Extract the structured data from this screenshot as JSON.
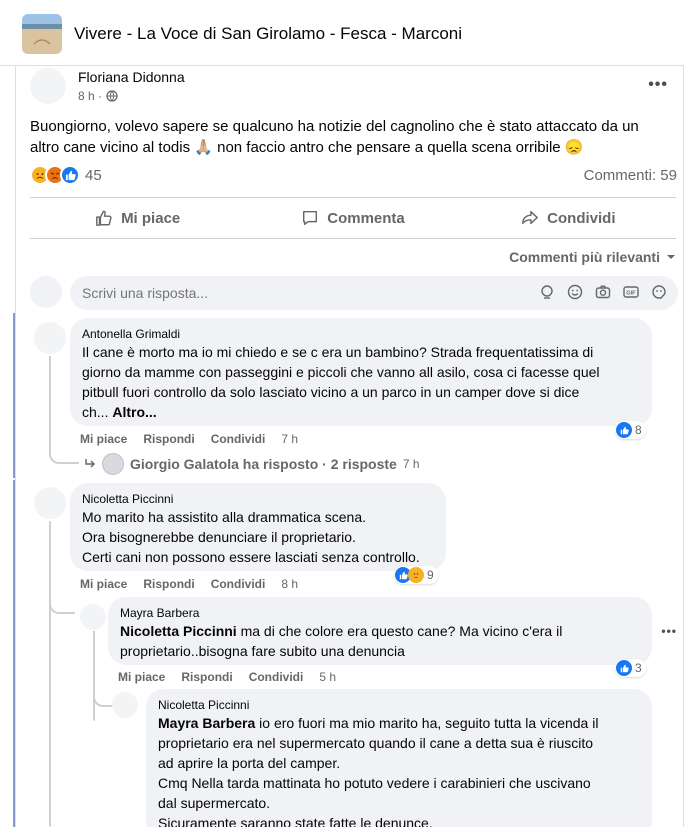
{
  "group": {
    "title": "Vivere - La Voce di San Girolamo - Fesca - Marconi"
  },
  "post": {
    "author": "Floriana Didonna",
    "time": "8 h ·",
    "more": "•••",
    "text": "Buongiorno, volevo sapere se qualcuno ha notizie del cagnolino che è stato attaccato da un altro cane vicino al todis 🙏🏼 non faccio antro che pensare a quella scena orribile 😞",
    "reaction_count": "45",
    "comments_count": "Commenti: 59",
    "reactions": [
      "sad",
      "angry",
      "like"
    ]
  },
  "actions": {
    "like": "Mi piace",
    "comment": "Commenta",
    "share": "Condividi"
  },
  "sort": {
    "label": "Commenti più rilevanti"
  },
  "reply_box": {
    "placeholder": "Scrivi una risposta..."
  },
  "comments": [
    {
      "name": "Antonella Grimaldi",
      "lines": [
        "Il cane è morto ma io mi chiedo e se c era un bambino? Strada frequentatissima di",
        "giorno da mamme con passeggini e piccoli che vanno all asilo, cosa ci facesse quel",
        "pitbull fuori controllo da solo lasciato vicino a un parco in un camper dove si dice",
        "ch..."
      ],
      "more": "Altro...",
      "like": "Mi piace",
      "reply": "Rispondi",
      "share": "Condividi",
      "time": "7 h",
      "reactions": "8",
      "replies": {
        "text": "Giorgio Galatola ha risposto · 2 risposte",
        "time": "7 h"
      }
    },
    {
      "name": "Nicoletta Piccinni",
      "lines": [
        "Mo marito ha assistito alla drammatica scena.",
        "Ora bisognerebbe denunciare il proprietario.",
        "Certi cani non possono essere lasciati senza controllo."
      ],
      "like": "Mi piace",
      "reply": "Rispondi",
      "share": "Condividi",
      "time": "8 h",
      "reactions": "9"
    },
    {
      "name": "Mayra Barbera",
      "mention": "Nicoletta Piccinni",
      "line1": " ma di che colore era questo cane? Ma vicino c'era il",
      "line2": "proprietario..bisogna fare subito una denuncia",
      "like": "Mi piace",
      "reply": "Rispondi",
      "share": "Condividi",
      "time": "5 h",
      "reactions": "3"
    },
    {
      "name": "Nicoletta Piccinni",
      "mention": "Mayra Barbera",
      "line1": " io ero fuori ma mio marito ha, seguito tutta la vicenda il",
      "lines": [
        "proprietario era nel supermercato quando il cane a detta sua è riuscito",
        "ad aprire la porta del camper.",
        "Cmq Nella tarda mattinata ho potuto vedere i carabinieri che uscivano",
        "dal supermercato.",
        "Sicuramente saranno state fatte le denunce."
      ]
    }
  ]
}
